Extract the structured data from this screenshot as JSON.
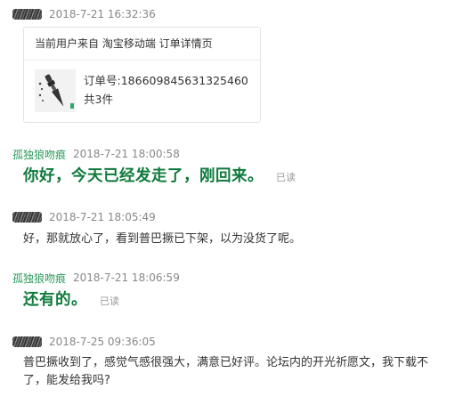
{
  "messages": [
    {
      "sender": "",
      "timestamp": "2018-7-21 16:32:36",
      "card": {
        "source_text": "当前用户来自 淘宝移动端 订单详情页",
        "order_label": "订单号:",
        "order_number": "186609845631325460",
        "quantity_text": "共3件"
      }
    },
    {
      "sender": "孤独狼吻痕",
      "timestamp": "2018-7-21 18:00:58",
      "text": "你好，今天已经发走了，刚回来。",
      "read_status": "已读"
    },
    {
      "sender": "",
      "timestamp": "2018-7-21 18:05:49",
      "text": "好，那就放心了，看到普巴撅已下架，以为没货了呢。"
    },
    {
      "sender": "孤独狼吻痕",
      "timestamp": "2018-7-21 18:06:59",
      "text": "还有的。",
      "read_status": "已读"
    },
    {
      "sender": "",
      "timestamp": "2018-7-25 09:36:05",
      "text_line1": "普巴撅收到了，感觉气感很强大，满意已好评。论坛内的开光祈愿文，我下载不",
      "text_line2": "了，能发给我吗?"
    }
  ],
  "colors": {
    "seller_name": "#2a9a5b",
    "seller_message": "#0f7a3c",
    "timestamp": "#888888",
    "read_status": "#999999"
  }
}
